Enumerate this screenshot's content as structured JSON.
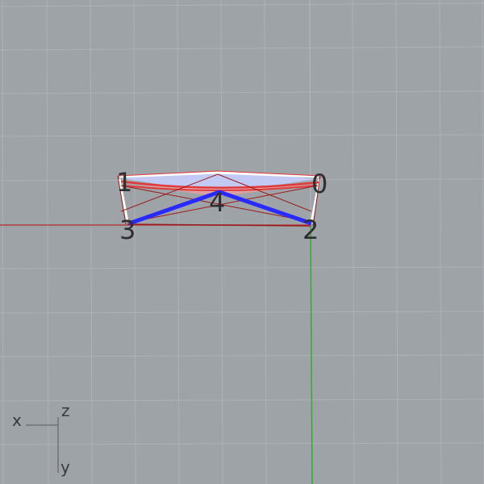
{
  "viewport": {
    "background": "#9ea3a8",
    "grid_color": "#aeb2b6",
    "grid_major_color": "#b6babe",
    "x_axis_color": "#b3413f",
    "y_axis_color": "#3aa63a"
  },
  "vertex_labels": [
    "0",
    "1",
    "2",
    "3",
    "4"
  ],
  "axis_gizmo": {
    "x_label": "x",
    "z_label": "z",
    "y_label": "y"
  },
  "mesh": {
    "edge_color": "#ffffff",
    "red_wire_color": "#e03a3a",
    "dark_red_wire_color": "#9a1b1b",
    "blue_edge_color": "#2a2aff",
    "highlight_color": "#c8d0ff"
  }
}
